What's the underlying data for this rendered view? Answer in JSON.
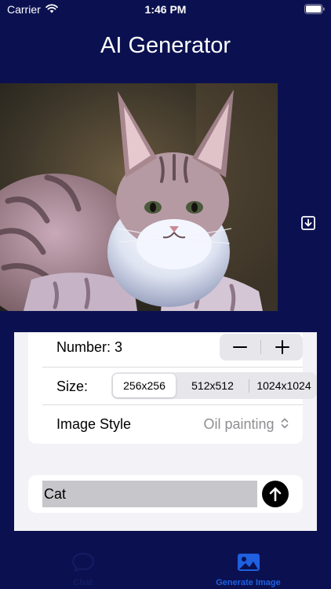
{
  "status_bar": {
    "carrier": "Carrier",
    "time": "1:46 PM",
    "icons": [
      "wifi-icon",
      "battery-icon"
    ]
  },
  "app_title": "AI Generator",
  "generated_image": {
    "alt": "Oil painting of a tabby cat",
    "icon": "cat-painting"
  },
  "save_button": {
    "icon": "download-icon"
  },
  "settings": {
    "number_label": "Number: 3",
    "number_value": 3,
    "stepper": {
      "decrement_icon": "minus-icon",
      "increment_icon": "plus-icon"
    },
    "size_label": "Size:",
    "size_options": [
      "256x256",
      "512x512",
      "1024x1024"
    ],
    "size_selected": "256x256",
    "style_label": "Image Style",
    "style_value": "Oil painting",
    "style_icon": "chevron-up-down-icon"
  },
  "prompt": {
    "value": "Cat",
    "placeholder": "",
    "send_icon": "arrow-up-icon"
  },
  "tabs": [
    {
      "label": "Chat",
      "icon": "chat-bubble-icon",
      "selected": false
    },
    {
      "label": "Generate Image",
      "icon": "photo-icon",
      "selected": true
    }
  ],
  "colors": {
    "background": "#0b1150",
    "accent": "#1f5fe0",
    "panel": "#f2f2f7",
    "segment_bg": "#e6e6eb",
    "prompt_field": "#c7c7cb"
  }
}
